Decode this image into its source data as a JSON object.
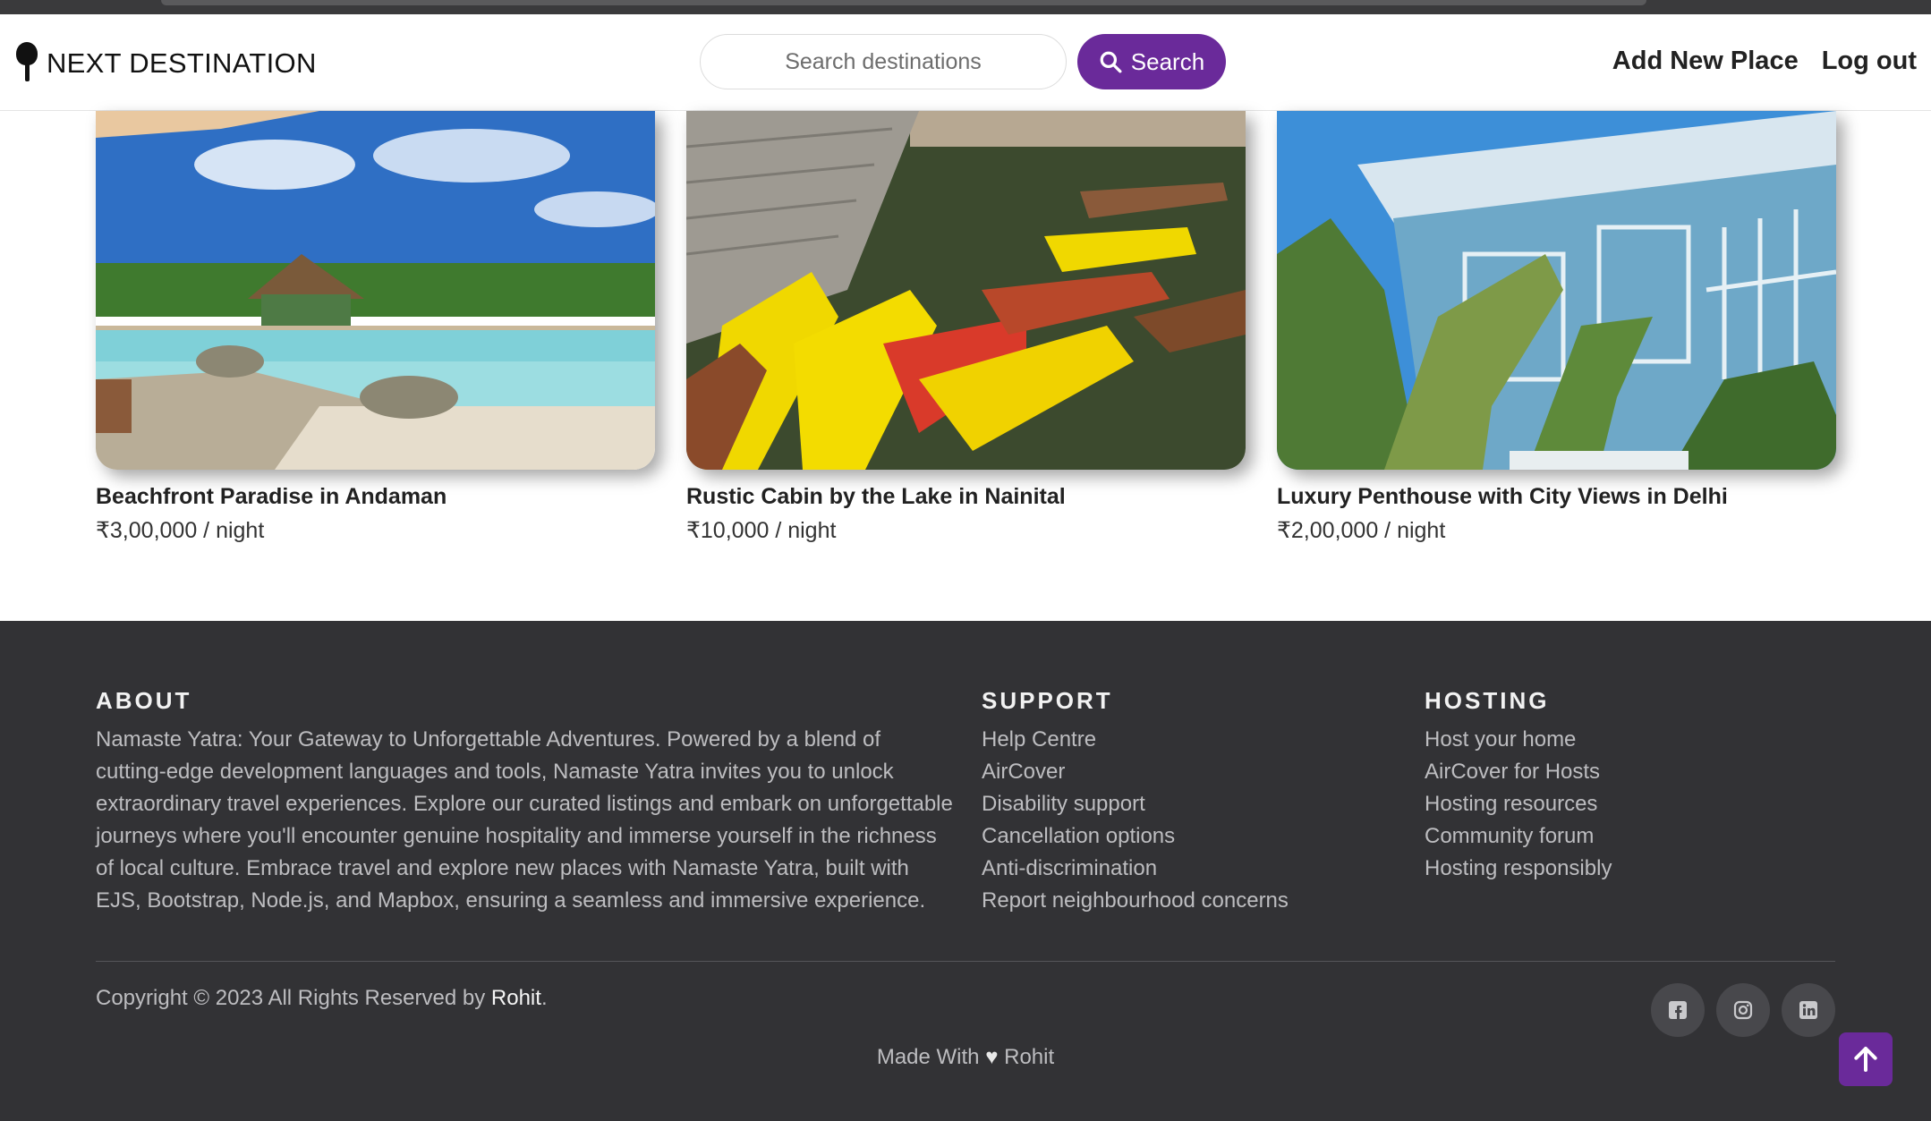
{
  "navbar": {
    "brand": "NEXT DESTINATION",
    "search_placeholder": "Search destinations",
    "search_button": "Search",
    "links": [
      "Add New Place",
      "Log out"
    ]
  },
  "listings": [
    {
      "title": "Beachfront Paradise in Andaman",
      "price": "₹3,00,000",
      "unit": " / night"
    },
    {
      "title": "Rustic Cabin by the Lake in Nainital",
      "price": "₹10,000",
      "unit": " / night"
    },
    {
      "title": "Luxury Penthouse with City Views in Delhi",
      "price": "₹2,00,000",
      "unit": " / night"
    }
  ],
  "footer": {
    "about": {
      "heading": "ABOUT",
      "text": "Namaste Yatra: Your Gateway to Unforgettable Adventures. Powered by a blend of cutting-edge development languages and tools, Namaste Yatra invites you to unlock extraordinary travel experiences. Explore our curated listings and embark on unforgettable journeys where you'll encounter genuine hospitality and immerse yourself in the richness of local culture. Embrace travel and explore new places with Namaste Yatra, built with EJS, Bootstrap, Node.js, and Mapbox, ensuring a seamless and immersive experience."
    },
    "support": {
      "heading": "SUPPORT",
      "items": [
        "Help Centre",
        "AirCover",
        "Disability support",
        "Cancellation options",
        "Anti-discrimination",
        "Report neighbourhood concerns"
      ]
    },
    "hosting": {
      "heading": "HOSTING",
      "items": [
        "Host your home",
        "AirCover for Hosts",
        "Hosting resources",
        "Community forum",
        "Hosting responsibly"
      ]
    },
    "copyright_prefix": "Copyright © 2023 All Rights Reserved by ",
    "copyright_owner": "Rohit",
    "copyright_suffix": ".",
    "made_with_prefix": "Made With ",
    "made_with_suffix": " Rohit",
    "socials": [
      "facebook-icon",
      "instagram-icon",
      "linkedin-icon"
    ]
  },
  "colors": {
    "accent": "#6a2a9a",
    "footer_bg": "#323235"
  }
}
